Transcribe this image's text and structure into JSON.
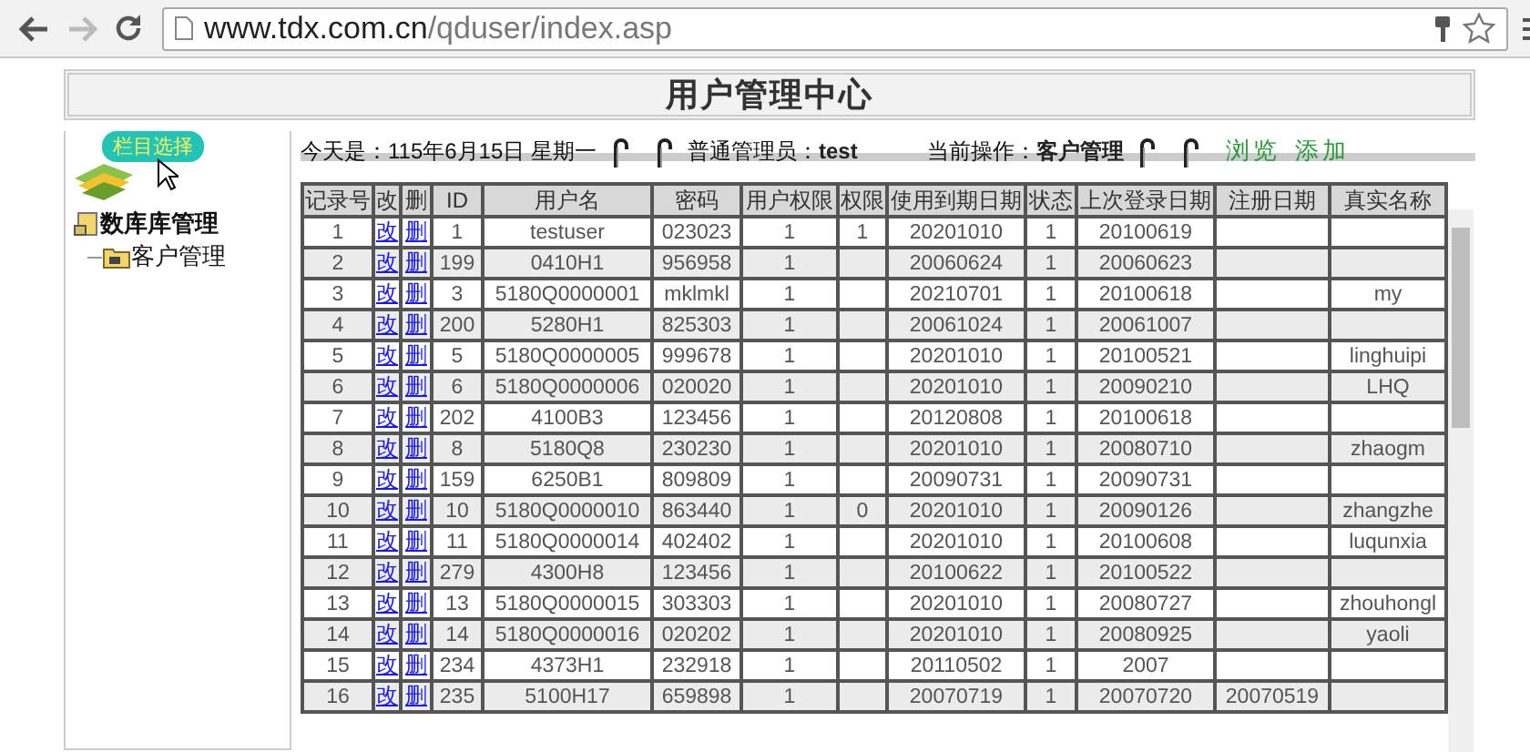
{
  "browser": {
    "url_host": "www.tdx.com.cn",
    "url_path": "/qduser/index.asp"
  },
  "header": {
    "title": "用户管理中心"
  },
  "info": {
    "date": "今天是：115年6月15日 星期一",
    "admin_label": "普通管理员：",
    "admin_value": "test",
    "operation_label": "当前操作：",
    "operation_value": "客户管理",
    "links": [
      "浏览",
      "添加"
    ]
  },
  "sidebar": {
    "badge": "栏目选择",
    "tree": [
      {
        "label": "数库库管理",
        "children": [
          {
            "label": "客户管理"
          }
        ]
      }
    ]
  },
  "table": {
    "columns": [
      {
        "label": "记录号",
        "kind": "text"
      },
      {
        "label": "改",
        "kind": "link"
      },
      {
        "label": "删",
        "kind": "link"
      },
      {
        "label": "ID",
        "kind": "text"
      },
      {
        "label": "用户名",
        "kind": "text"
      },
      {
        "label": "密码",
        "kind": "text"
      },
      {
        "label": "用户权限",
        "kind": "text"
      },
      {
        "label": "权限",
        "kind": "text"
      },
      {
        "label": "使用到期日期",
        "kind": "text"
      },
      {
        "label": "状态",
        "kind": "text"
      },
      {
        "label": "上次登录日期",
        "kind": "text"
      },
      {
        "label": "注册日期",
        "kind": "text"
      },
      {
        "label": "真实名称",
        "kind": "text"
      }
    ],
    "rows": [
      [
        "1",
        "改",
        "删",
        "1",
        "testuser",
        "023023",
        "1",
        "1",
        "20201010",
        "1",
        "20100619",
        "",
        ""
      ],
      [
        "2",
        "改",
        "删",
        "199",
        "0410H1",
        "956958",
        "1",
        "",
        "20060624",
        "1",
        "20060623",
        "",
        ""
      ],
      [
        "3",
        "改",
        "删",
        "3",
        "5180Q0000001",
        "mklmkl",
        "1",
        "",
        "20210701",
        "1",
        "20100618",
        "",
        "my"
      ],
      [
        "4",
        "改",
        "删",
        "200",
        "5280H1",
        "825303",
        "1",
        "",
        "20061024",
        "1",
        "20061007",
        "",
        ""
      ],
      [
        "5",
        "改",
        "删",
        "5",
        "5180Q0000005",
        "999678",
        "1",
        "",
        "20201010",
        "1",
        "20100521",
        "",
        "linghuipi"
      ],
      [
        "6",
        "改",
        "删",
        "6",
        "5180Q0000006",
        "020020",
        "1",
        "",
        "20201010",
        "1",
        "20090210",
        "",
        "LHQ"
      ],
      [
        "7",
        "改",
        "删",
        "202",
        "4100B3",
        "123456",
        "1",
        "",
        "20120808",
        "1",
        "20100618",
        "",
        ""
      ],
      [
        "8",
        "改",
        "删",
        "8",
        "5180Q8",
        "230230",
        "1",
        "",
        "20201010",
        "1",
        "20080710",
        "",
        "zhaogm"
      ],
      [
        "9",
        "改",
        "删",
        "159",
        "6250B1",
        "809809",
        "1",
        "",
        "20090731",
        "1",
        "20090731",
        "",
        ""
      ],
      [
        "10",
        "改",
        "删",
        "10",
        "5180Q0000010",
        "863440",
        "1",
        "0",
        "20201010",
        "1",
        "20090126",
        "",
        "zhangzhe"
      ],
      [
        "11",
        "改",
        "删",
        "11",
        "5180Q0000014",
        "402402",
        "1",
        "",
        "20201010",
        "1",
        "20100608",
        "",
        "luqunxia"
      ],
      [
        "12",
        "改",
        "删",
        "279",
        "4300H8",
        "123456",
        "1",
        "",
        "20100622",
        "1",
        "20100522",
        "",
        ""
      ],
      [
        "13",
        "改",
        "删",
        "13",
        "5180Q0000015",
        "303303",
        "1",
        "",
        "20201010",
        "1",
        "20080727",
        "",
        "zhouhongl"
      ],
      [
        "14",
        "改",
        "删",
        "14",
        "5180Q0000016",
        "020202",
        "1",
        "",
        "20201010",
        "1",
        "20080925",
        "",
        "yaoli"
      ],
      [
        "15",
        "改",
        "删",
        "234",
        "4373H1",
        "232918",
        "1",
        "",
        "20110502",
        "1",
        "2007",
        "",
        ""
      ],
      [
        "16",
        "改",
        "删",
        "235",
        "5100H17",
        "659898",
        "1",
        "",
        "20070719",
        "1",
        "20070720",
        "20070519",
        ""
      ]
    ]
  }
}
